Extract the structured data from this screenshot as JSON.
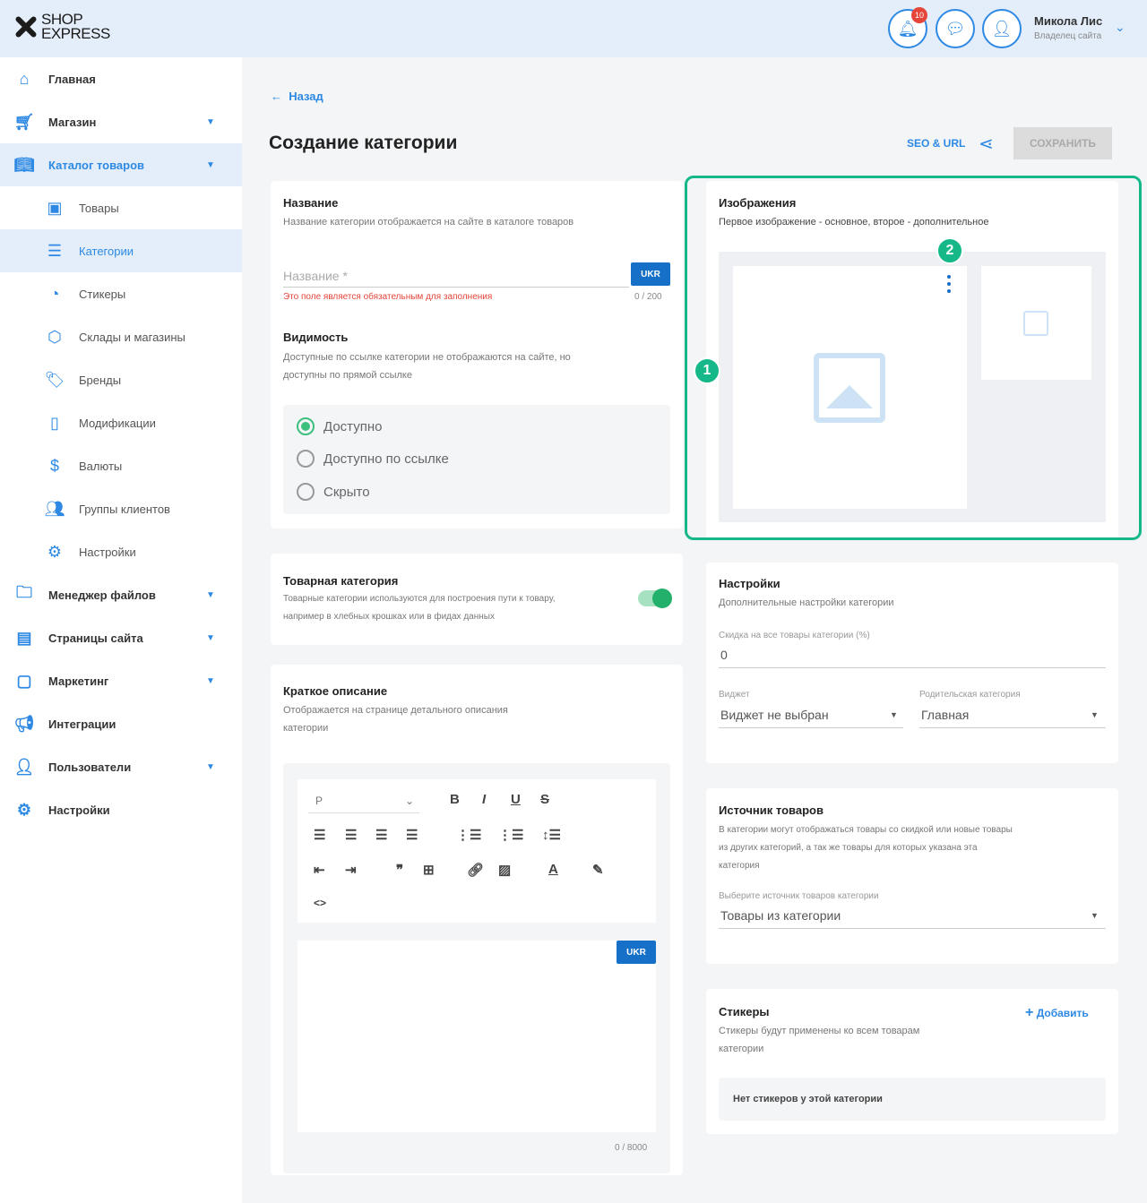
{
  "header": {
    "logo_line1": "SHOP",
    "logo_line2": "EXPRESS",
    "notifications_count": "10",
    "user_name": "Микола Лис",
    "user_role": "Владелец сайта"
  },
  "sidebar": {
    "items": [
      {
        "label": "Главная",
        "icon": "home-icon"
      },
      {
        "label": "Магазин",
        "icon": "cart-icon"
      },
      {
        "label": "Каталог товаров",
        "icon": "book-icon"
      },
      {
        "label": "Товары",
        "icon": "bag-icon"
      },
      {
        "label": "Категории",
        "icon": "list-icon"
      },
      {
        "label": "Стикеры",
        "icon": "sticker-icon"
      },
      {
        "label": "Склады и магазины",
        "icon": "box-icon"
      },
      {
        "label": "Бренды",
        "icon": "tag-icon"
      },
      {
        "label": "Модификации",
        "icon": "bookmark-icon"
      },
      {
        "label": "Валюты",
        "icon": "dollar-icon"
      },
      {
        "label": "Группы клиентов",
        "icon": "users-icon"
      },
      {
        "label": "Настройки",
        "icon": "gear-icon"
      },
      {
        "label": "Менеджер файлов",
        "icon": "folder-icon"
      },
      {
        "label": "Страницы сайта",
        "icon": "pages-icon"
      },
      {
        "label": "Маркетинг",
        "icon": "marketing-icon"
      },
      {
        "label": "Интеграции",
        "icon": "megaphone-icon"
      },
      {
        "label": "Пользователи",
        "icon": "user-icon"
      },
      {
        "label": "Настройки",
        "icon": "gear-icon"
      }
    ]
  },
  "main": {
    "back": "Назад",
    "title": "Создание категории",
    "seo_url": "SEO & URL",
    "save": "СОХРАНИТЬ"
  },
  "name_card": {
    "title": "Название",
    "desc": "Название категории отображается на сайте в каталоге товаров",
    "placeholder": "Название *",
    "lang": "UKR",
    "error": "Это поле является обязательным для заполнения",
    "counter": "0 / 200",
    "visibility_title": "Видимость",
    "visibility_desc_1": "Доступные по ссылке категории не отображаются на сайте, но",
    "visibility_desc_2": "доступны по прямой ссылке",
    "options": [
      "Доступно",
      "Доступно по ссылке",
      "Скрыто"
    ]
  },
  "product_category": {
    "title": "Товарная категория",
    "desc_1": "Товарные категории используются для построения пути к товару,",
    "desc_2": "например в хлебных крошках или в фидах данных"
  },
  "short_desc": {
    "title": "Краткое описание",
    "desc_1": "Отображается на странице детального описания",
    "desc_2": "категории",
    "format": "P",
    "lang": "UKR",
    "counter": "0 / 8000"
  },
  "images": {
    "title": "Изображения",
    "desc": "Первое изображение - основное, второе - дополнительное",
    "marker1": "1",
    "marker2": "2"
  },
  "settings": {
    "title": "Настройки",
    "desc": "Дополнительные настройки категории",
    "discount_label": "Скидка на все товары категории (%)",
    "discount_value": "0",
    "widget_label": "Виджет",
    "widget_value": "Виджет не выбран",
    "parent_label": "Родительская категория",
    "parent_value": "Главная"
  },
  "source": {
    "title": "Источник товаров",
    "desc_1": "В категории могут отображаться товары со скидкой или новые товары",
    "desc_2": "из других категорий, а так же товары для которых указана эта",
    "desc_3": "категория",
    "select_label": "Выберите источник товаров категории",
    "select_value": "Товары из категории"
  },
  "stickers": {
    "title": "Стикеры",
    "add": "Добавить",
    "desc_1": "Стикеры будут применены ко всем товарам",
    "desc_2": "категории",
    "empty": "Нет стикеров у этой категории"
  },
  "colors": {
    "accent": "#2d89e3",
    "highlight": "#16b88a",
    "error": "#e6453a"
  }
}
